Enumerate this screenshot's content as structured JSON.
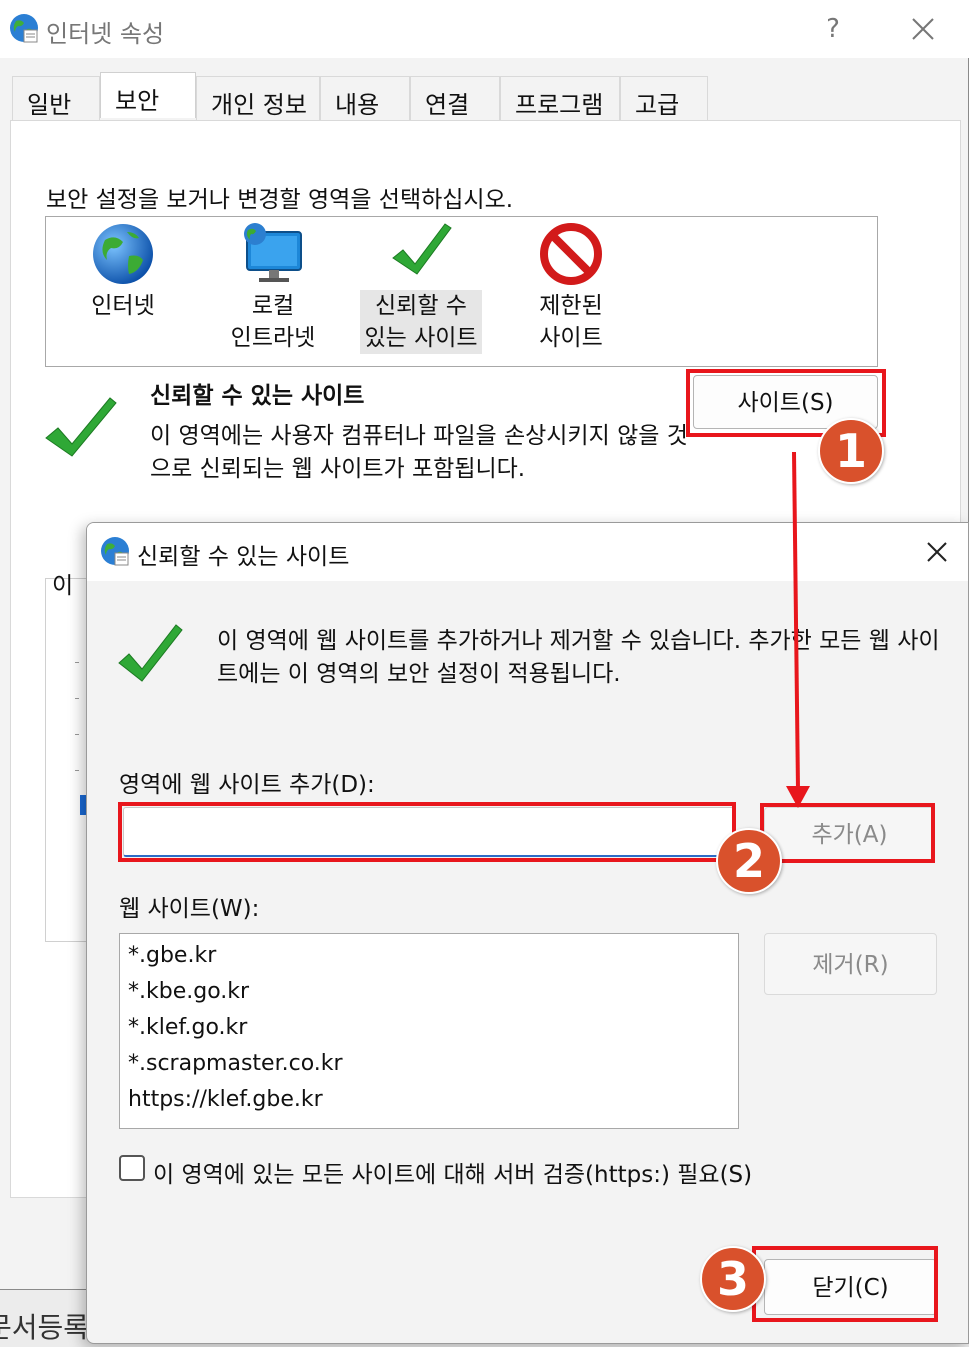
{
  "window": {
    "title": "인터넷 속성",
    "help": "?"
  },
  "tabs": [
    {
      "label": "일반"
    },
    {
      "label": "보안"
    },
    {
      "label": "개인 정보"
    },
    {
      "label": "내용"
    },
    {
      "label": "연결"
    },
    {
      "label": "프로그램"
    },
    {
      "label": "고급"
    }
  ],
  "security": {
    "prompt": "보안 설정을 보거나 변경할 영역을 선택하십시오.",
    "zones": [
      {
        "label": "인터넷",
        "icon": "globe-icon"
      },
      {
        "label": "로컬\n인트라넷",
        "icon": "monitor-globe-icon"
      },
      {
        "label": "신뢰할 수\n있는 사이트",
        "icon": "check-icon"
      },
      {
        "label": "제한된\n사이트",
        "icon": "prohibited-icon"
      }
    ],
    "selected_title": "신뢰할 수 있는 사이트",
    "selected_desc": "이 영역에는 사용자 컴퓨터나 파일을 손상시키지 않을 것으로 신뢰되는 웹 사이트가 포함됩니다.",
    "sites_button": "사이트(S)",
    "level_label_partial": "이"
  },
  "dialog": {
    "title": "신뢰할 수 있는 사이트",
    "description": "이 영역에 웹 사이트를 추가하거나 제거할 수 있습니다. 추가한 모든 웹 사이트에는 이 영역의 보안 설정이 적용됩니다.",
    "add_label": "영역에 웹 사이트 추가(D):",
    "add_input_value": "",
    "add_button": "추가(A)",
    "sites_label": "웹 사이트(W):",
    "sites": [
      "*.gbe.kr",
      "*.kbe.go.kr",
      "*.klef.go.kr",
      "*.scrapmaster.co.kr",
      "https://klef.gbe.kr"
    ],
    "remove_button": "제거(R)",
    "https_checkbox_label": "이 영역에 있는 모든 사이트에 대해 서버 검증(https:) 필요(S)",
    "https_checked": false,
    "close_button": "닫기(C)"
  },
  "background_text": "문서등록",
  "annotations": {
    "steps": [
      "1",
      "2",
      "3"
    ],
    "highlight_color": "#e8161c",
    "badge_color": "#d9512c"
  },
  "colors": {
    "accent": "#2d6cc7",
    "check_green": "#2fa836"
  }
}
